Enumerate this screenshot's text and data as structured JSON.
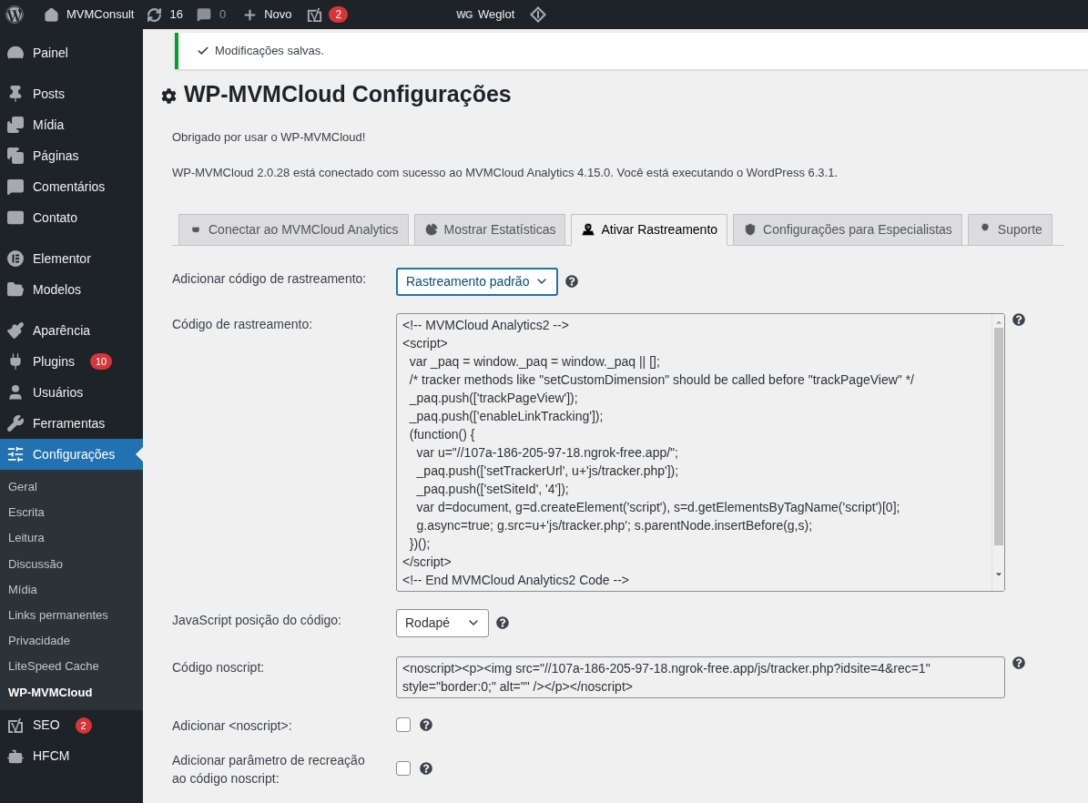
{
  "admin_bar": {
    "site": "MVMConsult",
    "updates": "16",
    "comments": "0",
    "new": "Novo",
    "seo_badge": "2",
    "weglot_logo": "WG",
    "weglot": "Weglot"
  },
  "sidebar": {
    "groups": [
      [
        {
          "label": "Painel",
          "selected": false
        }
      ],
      [
        {
          "label": "Posts",
          "selected": false
        },
        {
          "label": "Mídia",
          "selected": false
        },
        {
          "label": "Páginas",
          "selected": false
        },
        {
          "label": "Comentários",
          "selected": false
        },
        {
          "label": "Contato",
          "selected": false
        }
      ],
      [
        {
          "label": "Elementor",
          "selected": false
        },
        {
          "label": "Modelos",
          "selected": false
        }
      ],
      [
        {
          "label": "Aparência",
          "selected": false
        },
        {
          "label": "Plugins",
          "selected": false,
          "badge": "10"
        },
        {
          "label": "Usuários",
          "selected": false
        },
        {
          "label": "Ferramentas",
          "selected": false
        },
        {
          "label": "Configurações",
          "selected": true,
          "children": [
            {
              "label": "Geral",
              "selected": false
            },
            {
              "label": "Escrita",
              "selected": false
            },
            {
              "label": "Leitura",
              "selected": false
            },
            {
              "label": "Discussão",
              "selected": false
            },
            {
              "label": "Mídia",
              "selected": false
            },
            {
              "label": "Links permanentes",
              "selected": false
            },
            {
              "label": "Privacidade",
              "selected": false
            },
            {
              "label": "LiteSpeed Cache",
              "selected": false
            },
            {
              "label": "WP-MVMCloud",
              "selected": true
            }
          ]
        }
      ],
      [
        {
          "label": "SEO",
          "selected": false,
          "badge": "2"
        },
        {
          "label": "HFCM",
          "selected": false
        }
      ]
    ]
  },
  "notice": "Modificações salvas.",
  "title": "WP-MVMCloud Configurações",
  "intro": [
    "Obrigado por usar o WP-MVMCloud!",
    "WP-MVMCloud 2.0.28 está conectado com sucesso ao MVMCloud Analytics 4.15.0. Você está executando o WordPress 6.3.1."
  ],
  "tabs": [
    {
      "label": "Conectar ao MVMCloud Analytics",
      "selected": false
    },
    {
      "label": "Mostrar Estatísticas",
      "selected": false
    },
    {
      "label": "Ativar Rastreamento",
      "selected": true
    },
    {
      "label": "Configurações para Especialistas",
      "selected": false
    },
    {
      "label": "Suporte",
      "selected": false
    }
  ],
  "fields": [
    {
      "kind": "select",
      "label": "Adicionar código de rastreamento:",
      "value": "Rastreamento padrão",
      "focused": true
    },
    {
      "kind": "code",
      "label": "Código de rastreamento:",
      "value": "<!-- MVMCloud Analytics2 -->\n<script>\n  var _paq = window._paq = window._paq || [];\n  /* tracker methods like \"setCustomDimension\" should be called before \"trackPageView\" */\n  _paq.push(['trackPageView']);\n  _paq.push(['enableLinkTracking']);\n  (function() {\n    var u=\"//107a-186-205-97-18.ngrok-free.app/\";\n    _paq.push(['setTrackerUrl', u+'js/tracker.php']);\n    _paq.push(['setSiteId', '4']);\n    var d=document, g=d.createElement('script'), s=d.getElementsByTagName('script')[0];\n    g.async=true; g.src=u+'js/tracker.php'; s.parentNode.insertBefore(g,s);\n  })();\n</script>\n<!-- End MVMCloud Analytics2 Code -->"
    },
    {
      "kind": "select",
      "label": "JavaScript posição do código:",
      "value": "Rodapé",
      "focused": false
    },
    {
      "kind": "textarea",
      "label": "Código noscript:",
      "value": "<noscript><p><img src=\"//107a-186-205-97-18.ngrok-free.app/js/tracker.php?idsite=4&rec=1\"\nstyle=\"border:0;\" alt=\"\" /></p></noscript>"
    },
    {
      "kind": "checkbox",
      "label": "Adicionar <noscript>:",
      "checked": false
    },
    {
      "kind": "checkbox",
      "label": "Adicionar parâmetro de recreação ao código noscript:",
      "checked": false
    }
  ]
}
